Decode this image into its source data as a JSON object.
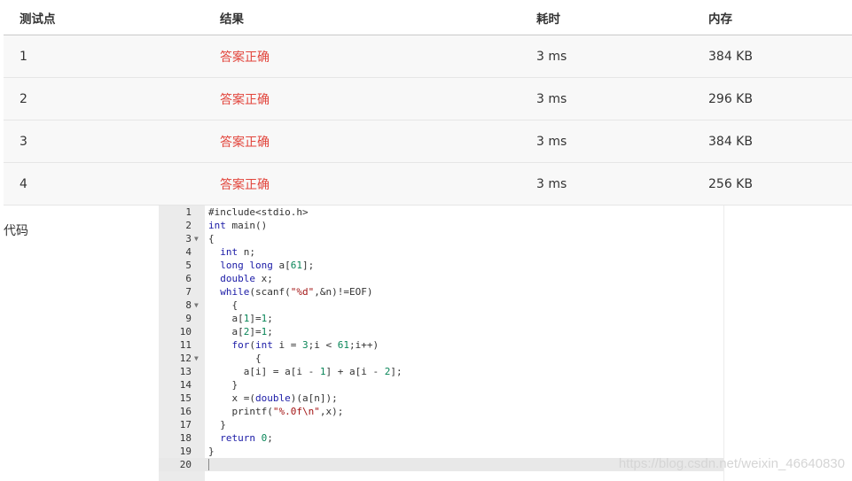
{
  "table": {
    "headers": {
      "test": "测试点",
      "result": "结果",
      "time": "耗时",
      "memory": "内存"
    },
    "rows": [
      {
        "test": "1",
        "result": "答案正确",
        "time": "3 ms",
        "memory": "384 KB"
      },
      {
        "test": "2",
        "result": "答案正确",
        "time": "3 ms",
        "memory": "296 KB"
      },
      {
        "test": "3",
        "result": "答案正确",
        "time": "3 ms",
        "memory": "384 KB"
      },
      {
        "test": "4",
        "result": "答案正确",
        "time": "3 ms",
        "memory": "256 KB"
      }
    ]
  },
  "code": {
    "label": "代码",
    "lines": [
      "#include<stdio.h>",
      "int main()",
      "{",
      "  int n;",
      "  long long a[61];",
      "  double x;",
      "  while(scanf(\"%d\",&n)!=EOF)",
      "    {",
      "    a[1]=1;",
      "    a[2]=1;",
      "    for(int i = 3;i < 61;i++)",
      "        {",
      "      a[i] = a[i - 1] + a[i - 2];",
      "    }",
      "    x =(double)(a[n]);",
      "    printf(\"%.0f\\n\",x);",
      "  }",
      "  return 0;",
      "}",
      ""
    ],
    "fold_lines": [
      3,
      8,
      12
    ],
    "active_line": 20
  },
  "watermark": "https://blog.csdn.net/weixin_46640830",
  "colors": {
    "accepted": "#e2453c",
    "gutter": "#ebebeb"
  }
}
